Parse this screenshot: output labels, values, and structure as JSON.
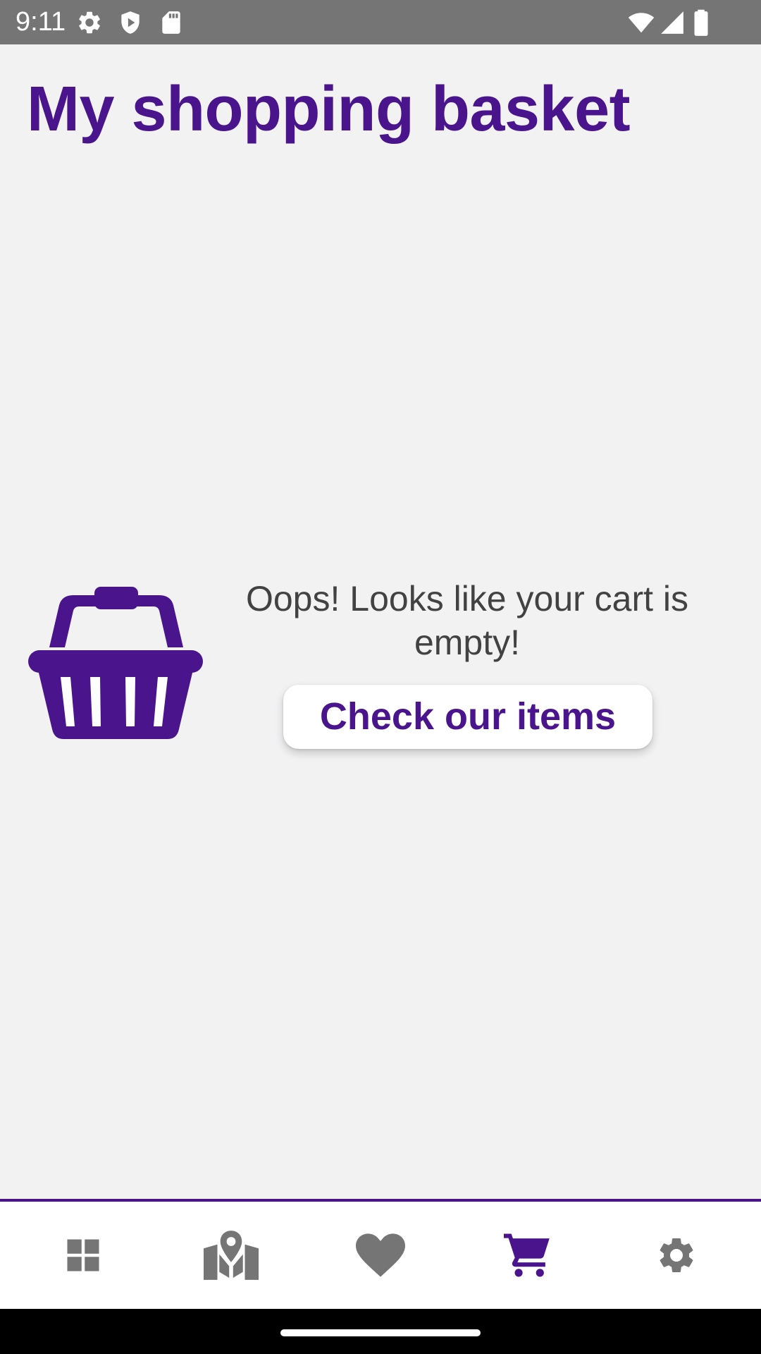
{
  "status_bar": {
    "time": "9:11",
    "left_icons": [
      "gear-icon",
      "shield-play-icon",
      "sd-card-icon"
    ],
    "right_icons": [
      "wifi-icon",
      "signal-icon",
      "battery-icon"
    ]
  },
  "header": {
    "title": "My shopping basket"
  },
  "empty_state": {
    "icon": "basket-icon",
    "message": "Oops! Looks like your cart is empty!",
    "button_label": "Check our items"
  },
  "bottom_nav": {
    "active_index": 3,
    "items": [
      {
        "name": "dashboard-icon",
        "active": false
      },
      {
        "name": "map-icon",
        "active": false
      },
      {
        "name": "heart-icon",
        "active": false
      },
      {
        "name": "cart-icon",
        "active": true
      },
      {
        "name": "settings-icon",
        "active": false
      }
    ]
  },
  "colors": {
    "accent": "#4a148c",
    "background": "#f2f2f3",
    "status_bar": "#757575",
    "inactive_icon": "#757575",
    "text": "#424242"
  }
}
